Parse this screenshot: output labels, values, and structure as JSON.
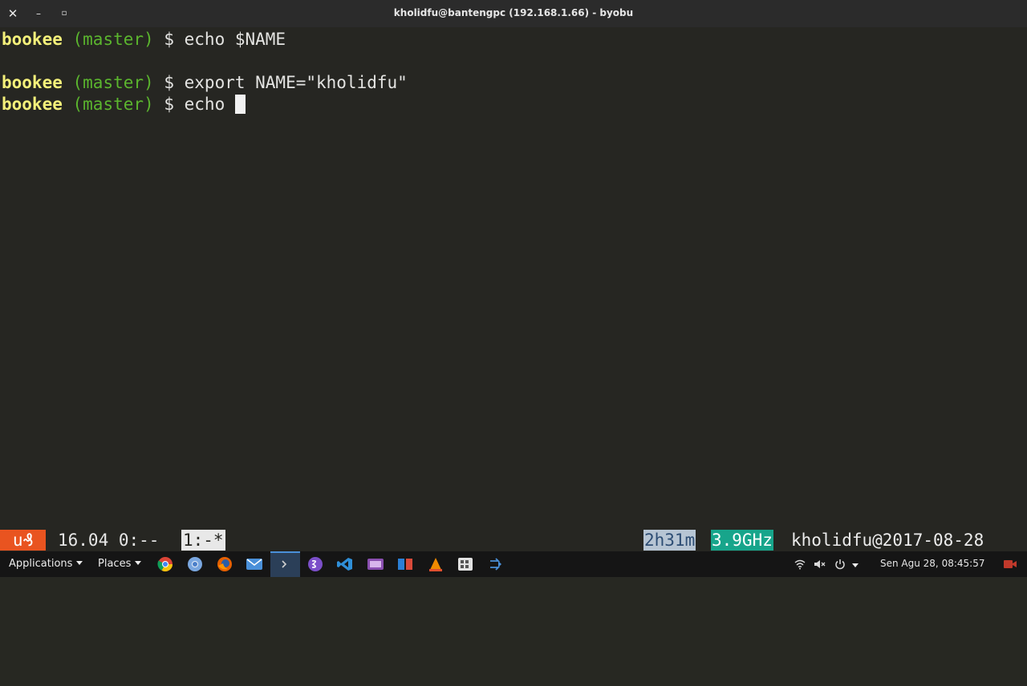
{
  "window": {
    "title": "kholidfu@bantengpc (192.168.1.66) - byobu",
    "close_glyph": "✕",
    "minimize_glyph": "–",
    "maximize_glyph": "▫"
  },
  "terminal": {
    "lines": [
      {
        "host": "bookee",
        "branch": "(master)",
        "prompt": "$",
        "command": "echo $NAME"
      },
      {
        "host": "bookee",
        "branch": "(master)",
        "prompt": "$",
        "command": "export NAME=\"kholidfu\""
      },
      {
        "host": "bookee",
        "branch": "(master)",
        "prompt": "$",
        "command": "echo "
      }
    ]
  },
  "status_bar": {
    "logo": "u₰",
    "release_load": "16.04 0:--",
    "window_list": "1:-*",
    "uptime": "2h31m",
    "cpu_freq": "3.9GHz",
    "user_date": "kholidfu@2017-08-28",
    "colors": {
      "logo_bg": "#e95420",
      "uptime_bg": "#b7c5d4",
      "cpu_bg": "#17a58b"
    }
  },
  "taskbar": {
    "applications_label": "Applications",
    "places_label": "Places",
    "launchers": [
      "chrome-icon",
      "chromium-icon",
      "firefox-icon",
      "mail-icon",
      "terminal-icon",
      "emacs-icon",
      "vscode-icon",
      "video-editor-icon",
      "files-icon",
      "vlc-icon",
      "calculator-icon",
      "share-icon"
    ],
    "tray_icons": [
      "wifi-icon",
      "volume-icon",
      "power-icon",
      "tray-menu-icon"
    ],
    "clock": "Sen Agu 28, 08:45:57"
  }
}
